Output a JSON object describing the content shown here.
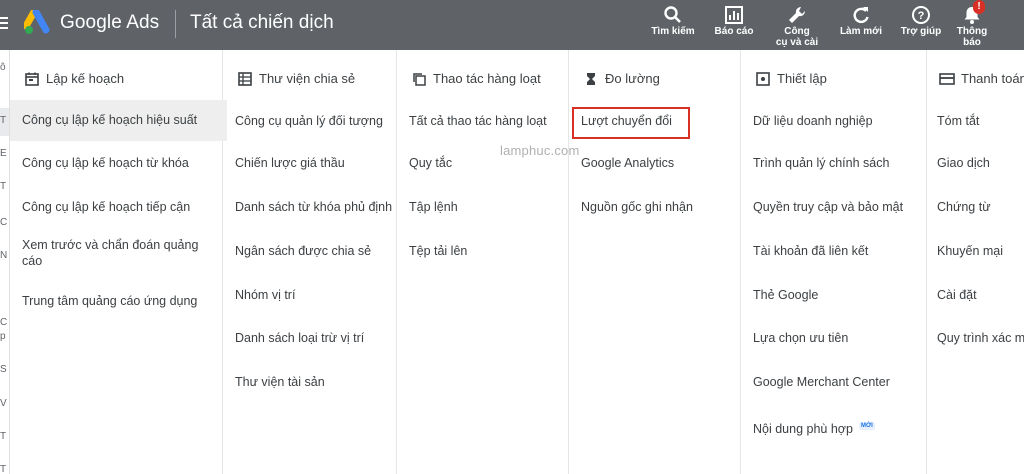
{
  "header": {
    "brand": "Google Ads",
    "page_title": "Tất cả chiến dịch",
    "tools": [
      {
        "label": "Tìm kiếm",
        "icon": "search-icon"
      },
      {
        "label": "Báo cáo",
        "icon": "reports-icon"
      },
      {
        "label": "Công\ncụ và cài",
        "icon": "wrench-icon"
      },
      {
        "label": "Làm mới",
        "icon": "refresh-icon"
      },
      {
        "label": "Trợ giúp",
        "icon": "help-icon"
      },
      {
        "label": "Thông\nbáo",
        "icon": "bell-icon",
        "badge": "!"
      }
    ]
  },
  "left_sliver": [
    "ô",
    "T",
    "E",
    "T",
    "C",
    "N",
    "C",
    "p",
    "S",
    "V",
    "T",
    "T"
  ],
  "watermark": "lamphuc.com",
  "columns": [
    {
      "title": "Lập kế hoạch",
      "icon": "calendar-icon",
      "items": [
        "Công cụ lập kế hoạch hiệu suất",
        "Công cụ lập kế hoạch từ khóa",
        "Công cụ lập kế hoạch tiếp cận",
        "Xem trước và chẩn đoán quảng cáo",
        "Trung tâm quảng cáo ứng dụng"
      ]
    },
    {
      "title": "Thư viện chia sẻ",
      "icon": "library-icon",
      "items": [
        "Công cụ quản lý đối tượng",
        "Chiến lược giá thầu",
        "Danh sách từ khóa phủ định",
        "Ngân sách được chia sẻ",
        "Nhóm vị trí",
        "Danh sách loại trừ vị trí",
        "Thư viện tài sản"
      ]
    },
    {
      "title": "Thao tác hàng loạt",
      "icon": "copy-icon",
      "items": [
        "Tất cả thao tác hàng loạt",
        "Quy tắc",
        "Tập lệnh",
        "Tệp tải lên"
      ]
    },
    {
      "title": "Đo lường",
      "icon": "hourglass-icon",
      "items": [
        "Lượt chuyển đổi",
        "Google Analytics",
        "Nguồn gốc ghi nhận"
      ]
    },
    {
      "title": "Thiết lập",
      "icon": "settings-box-icon",
      "items": [
        "Dữ liệu doanh nghiệp",
        "Trình quản lý chính sách",
        "Quyền truy cập và bảo mật",
        "Tài khoản đã liên kết",
        "Thẻ Google",
        "Lựa chọn ưu tiên",
        "Google Merchant Center",
        "Nội dung phù hợp"
      ],
      "new_badge": "MỚI"
    },
    {
      "title": "Thanh toán",
      "icon": "card-icon",
      "items": [
        "Tóm tắt",
        "Giao dịch",
        "Chứng từ",
        "Khuyến mại",
        "Cài đặt",
        "Quy trình xác mi"
      ]
    }
  ]
}
